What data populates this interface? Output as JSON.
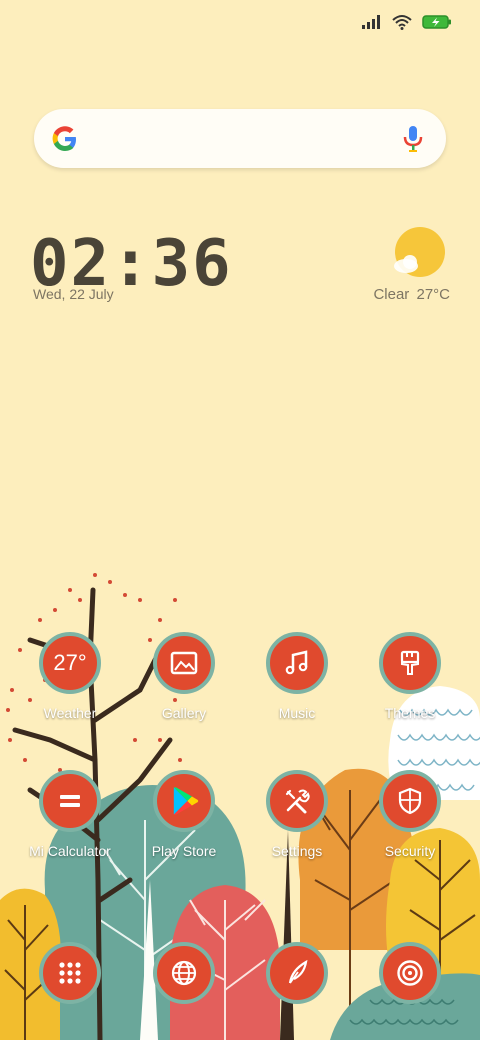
{
  "status_bar": {
    "icons": [
      "signal-icon",
      "wifi-icon",
      "battery-charging-icon"
    ],
    "battery_color": "#3fb83a"
  },
  "search": {
    "icons": [
      "google-logo-icon",
      "mic-icon"
    ]
  },
  "clock": {
    "time": "02:36",
    "date": "Wed, 22 July"
  },
  "weather": {
    "condition": "Clear",
    "temperature": "27°C",
    "icon": "sun-cloud-icon"
  },
  "apps": [
    {
      "id": "weather",
      "label": "Weather",
      "icon": "temperature-27-icon",
      "icon_text": "27°"
    },
    {
      "id": "gallery",
      "label": "Gallery",
      "icon": "image-icon"
    },
    {
      "id": "music",
      "label": "Music",
      "icon": "music-note-icon"
    },
    {
      "id": "themes",
      "label": "Themes",
      "icon": "paintbrush-icon"
    },
    {
      "id": "calculator",
      "label": "Mi Calculator",
      "icon": "equals-icon"
    },
    {
      "id": "play-store",
      "label": "Play Store",
      "icon": "play-store-icon"
    },
    {
      "id": "settings",
      "label": "Settings",
      "icon": "tools-icon"
    },
    {
      "id": "security",
      "label": "Security",
      "icon": "shield-icon"
    },
    {
      "id": "app-drawer",
      "label": "",
      "icon": "grid-dots-icon"
    },
    {
      "id": "browser",
      "label": "",
      "icon": "globe-icon"
    },
    {
      "id": "notes",
      "label": "",
      "icon": "quill-icon"
    },
    {
      "id": "camera",
      "label": "",
      "icon": "target-icon"
    }
  ],
  "colors": {
    "background": "#fdeebd",
    "icon_fill": "#e04a2e",
    "icon_ring": "#7db3a4",
    "clock_text": "#4a4437"
  }
}
